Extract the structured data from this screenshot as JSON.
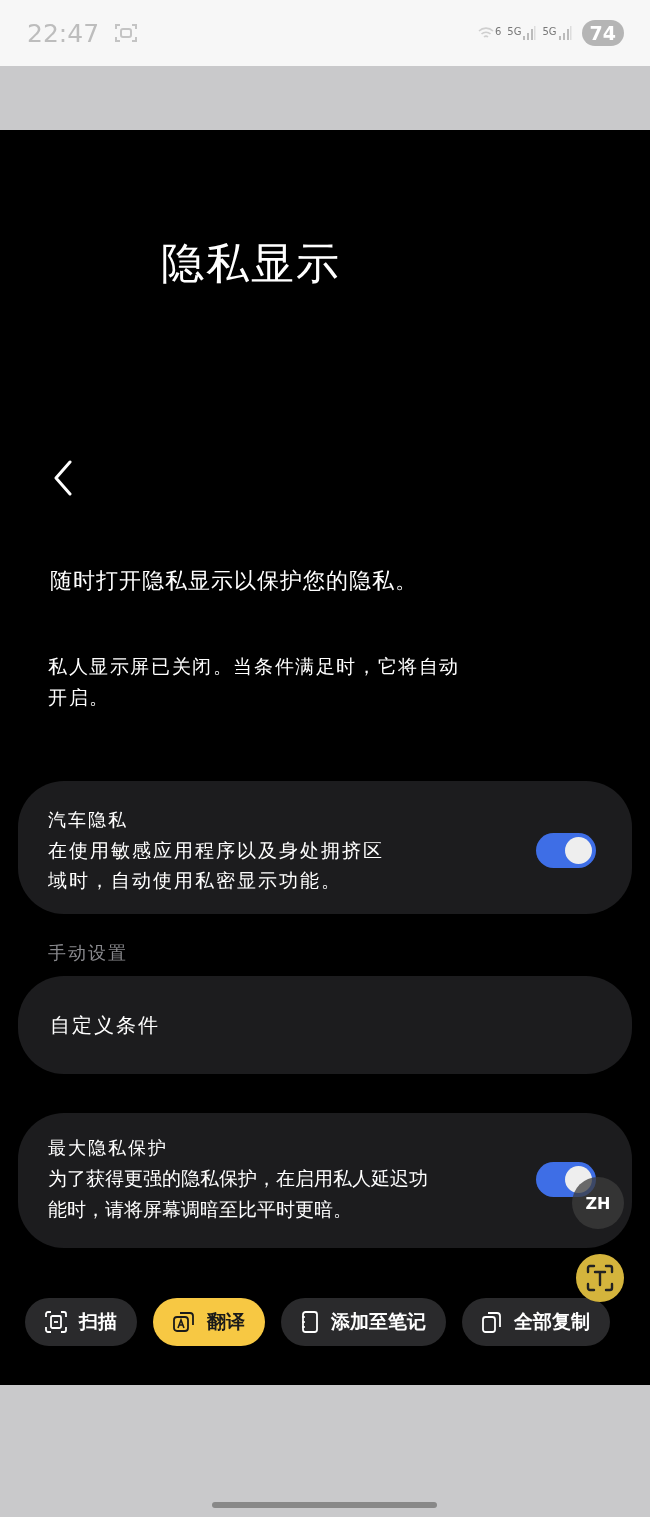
{
  "status_bar": {
    "time": "22:47",
    "wifi_generation": "6",
    "network_types": [
      "5G",
      "5G"
    ],
    "battery": "74"
  },
  "page": {
    "title": "隐私显示",
    "intro": "随时打开隐私显示以保护您的隐私。",
    "status": "私人显示屏已关闭。当条件满足时，它将自动开启。"
  },
  "settings": [
    {
      "kind": "toggle",
      "title": "汽车隐私",
      "description": "在使用敏感应用程序以及身处拥挤区域时，自动使用私密显示功能。",
      "on": true
    },
    {
      "kind": "header",
      "title": "手动设置"
    },
    {
      "kind": "link",
      "title": "自定义条件"
    },
    {
      "kind": "toggle",
      "title": "最大隐私保护",
      "description": "为了获得更强的隐私保护，在启用私人延迟功能时，请将屏幕调暗至比平时更暗。",
      "on": true
    }
  ],
  "overlay": {
    "language_badge": "ZH"
  },
  "toolbar": [
    {
      "kind": "scan",
      "label": "扫描",
      "selected": false
    },
    {
      "kind": "translate",
      "label": "翻译",
      "selected": true
    },
    {
      "kind": "note",
      "label": "添加至笔记",
      "selected": false
    },
    {
      "kind": "copy",
      "label": "全部复制",
      "selected": false
    }
  ]
}
